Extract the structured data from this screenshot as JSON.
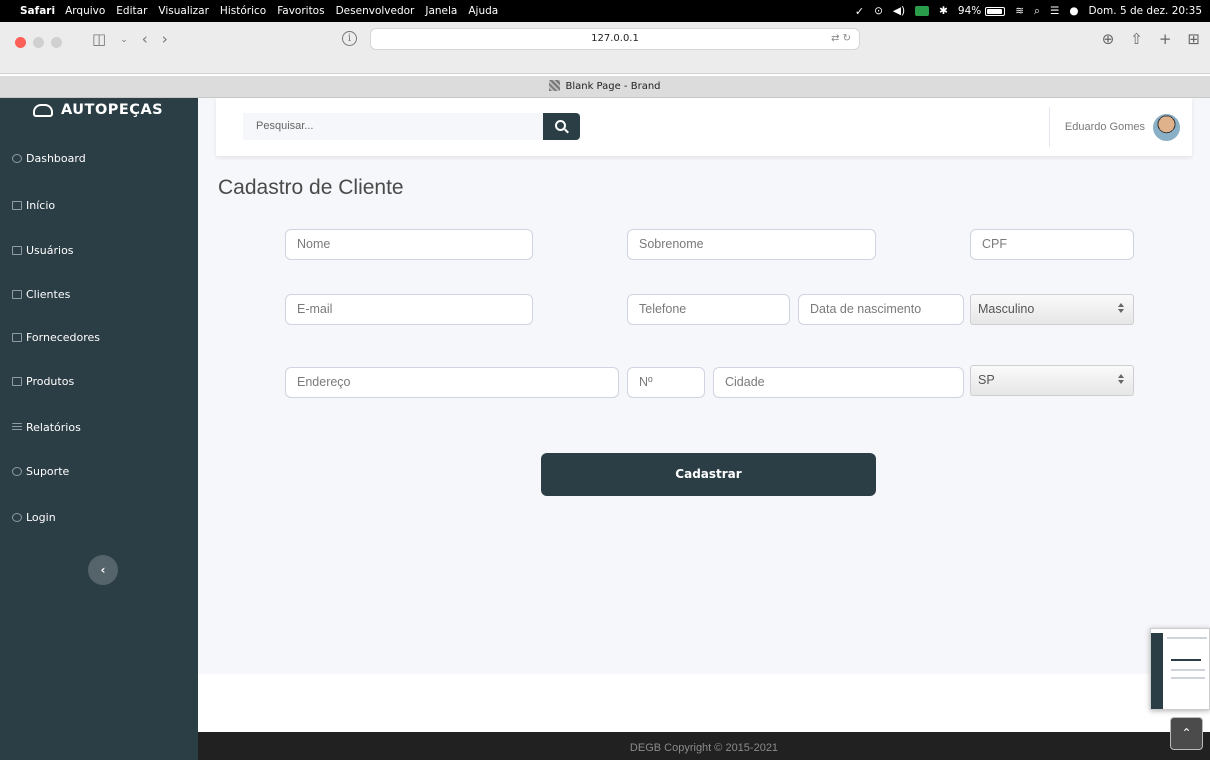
{
  "menubar": {
    "app": "Safari",
    "items": [
      "Arquivo",
      "Editar",
      "Visualizar",
      "Histórico",
      "Favoritos",
      "Desenvolvedor",
      "Janela",
      "Ajuda"
    ],
    "battery": "94%",
    "battery_level": 0.94,
    "datetime": "Dom. 5 de dez.  20:35"
  },
  "browser": {
    "url": "127.0.0.1",
    "tab_title": "Blank Page - Brand"
  },
  "sidebar": {
    "brand": "AUTOPEÇAS",
    "items": [
      {
        "label": "Dashboard",
        "icon": "palette-icon"
      },
      {
        "label": "Início",
        "icon": "window-icon"
      },
      {
        "label": "Usuários",
        "icon": "table-icon"
      },
      {
        "label": "Clientes",
        "icon": "table-icon"
      },
      {
        "label": "Fornecedores",
        "icon": "table-icon"
      },
      {
        "label": "Produtos",
        "icon": "table-icon"
      },
      {
        "label": "Relatórios",
        "icon": "list-icon"
      },
      {
        "label": "Suporte",
        "icon": "life-ring-icon"
      },
      {
        "label": "Login",
        "icon": "user-circle-icon"
      }
    ],
    "collapse_symbol": "‹"
  },
  "topbar": {
    "search_placeholder": "Pesquisar...",
    "user_name": "Eduardo Gomes"
  },
  "form": {
    "title": "Cadastro de Cliente",
    "fields": {
      "nome": "Nome",
      "sobrenome": "Sobrenome",
      "cpf": "CPF",
      "email": "E-mail",
      "telefone": "Telefone",
      "data_nascimento": "Data de nascimento",
      "sexo_selected": "Masculino",
      "endereco": "Endereço",
      "numero": "Nº",
      "cidade": "Cidade",
      "estado_selected": "SP"
    },
    "submit_label": "Cadastrar"
  },
  "footer": {
    "copyright": "DEGB Copyright © 2015-2021"
  },
  "colors": {
    "sidebar_bg": "#2b3d45",
    "main_bg": "#f6f7fa",
    "footer_bg": "#212121"
  }
}
